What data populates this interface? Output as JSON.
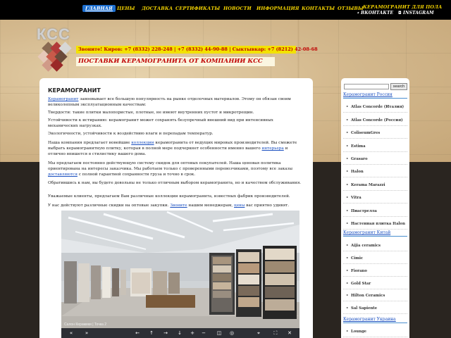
{
  "nav": {
    "items": [
      "ГЛАВНАЯ",
      "ЦЕНЫ",
      "ДОСТАВКА",
      "СЕРТИФИКАТЫ",
      "НОВОСТИ",
      "ИНФОРМАЦИЯ",
      "КОНТАКТЫ",
      "ОТЗЫВЫ",
      "КЕРАМОГРАНИТ ДЛЯ ПОЛА"
    ],
    "vk": "ВКОНТАКТЕ",
    "instagram": "INSTAGRAM"
  },
  "header": {
    "logo": "КСС",
    "phones": "Звоните! Киров: +7 (8332) 228-248 | +7 (8332) 44-90-88 | Сыктывкар: +7 (8212) 42-08-68",
    "slogan": "ПОСТАВКИ КЕРАМОГРАНИТА ОТ КОМПАНИИ КСС"
  },
  "main": {
    "title": "КЕРАМОГРАНИТ",
    "p1_link": "Керамогранит",
    "p1_rest": " завоевывает все большую популярность на рынке отделочных материалов. Этому он обязан своим великолепным эксплуатационным качествам:",
    "p2": "Твердости: такие плитки малопористые, плотные, не имеют внутренних пустот и микротрещин.",
    "p3": "Устойчивости к истиранию: керамогранит может сохранять безупречный внешний вид при интенсивных механических нагрузках.",
    "p4": "Экологичности, устойчивости к воздействию влаги и перепадам температур.",
    "p5_a": "Наша компания предлагает новейшие ",
    "p5_link1": "коллекции",
    "p5_b": " керамогранита от ведущих мировых производителей. Вы сможете выбрать керамогранитную плитку, которая в полной мере подчеркнет особенности именно вашего ",
    "p5_link2": "интерьера",
    "p5_c": " и отлично впишется в стилистику вашего дома.",
    "p6_a": "Мы предлагаем постоянно действующую систему скидок для оптовых покупателей. Наша ценовая политика ориентирована на интересы заказчика. Мы работаем только с проверенными перевозчиками, поэтому все заказы ",
    "p6_link": "доставляются",
    "p6_b": " с полной гарантией сохранности груза и точно в срок.",
    "p7": "Обратившись к нам, вы будете довольны не только отличным выбором керамогранита, но и качеством обслуживания.",
    "p8": "Уважаемые клиенты, предлагаем Вам различные коллекции керамогранита, известных фабрик производителей.",
    "p9_a": "У нас действуют различные скидки на оптовые закупки. ",
    "p9_link1": "Звоните",
    "p9_b": " нашим менеджерам, ",
    "p9_link2": "цены",
    "p9_c": " вас приятно удивят.",
    "viewer_caption": "Салон Керамики | Точка 2"
  },
  "sidebar": {
    "search_button": "search",
    "groups": [
      {
        "title": "Керамогранит Россия",
        "items": [
          "Atlas Concorde (Италия)",
          "Atlas Concorde (Россия)",
          "ColiseumGres",
          "Estima",
          "Grasaro",
          "Italon",
          "Kerama Marazzi",
          "Vitra",
          "Пиастрелла",
          "Настенная плитка Italon"
        ]
      },
      {
        "title": "Керамогранит Китай",
        "items": [
          "Aijia ceramics",
          "Cimic",
          "Fiorano",
          "Gold Star",
          "Hilton Ceramics",
          "Sal Sapiente"
        ]
      },
      {
        "title": "Керамогранит Украина",
        "items": [
          "Lounge"
        ]
      }
    ]
  },
  "colors": {
    "nav_bg": "#000000",
    "nav_text": "#f0d000",
    "active_nav": "#1d6fd0",
    "phone_bar": "#f3e200",
    "accent_red": "#c00000",
    "link": "#1a4fc0"
  }
}
